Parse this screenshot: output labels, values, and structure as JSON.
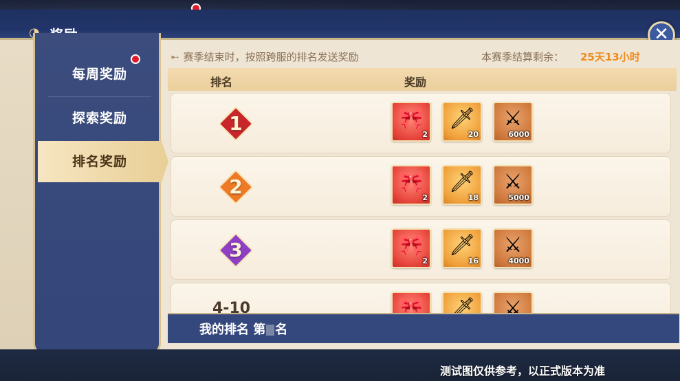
{
  "header": {
    "title": "奖励",
    "icon": "reward-icon",
    "close_label": "✕"
  },
  "sidebar": {
    "items": [
      {
        "label": "每周奖励",
        "active": false,
        "has_badge": true
      },
      {
        "label": "探索奖励",
        "active": false,
        "has_badge": false
      },
      {
        "label": "排名奖励",
        "active": true,
        "has_badge": false
      }
    ]
  },
  "notice": {
    "text": "赛季结束时，按照跨服的排名发送奖励",
    "season_label": "本赛季结算剩余：",
    "season_value": "25天13小时"
  },
  "table": {
    "col_rank": "排名",
    "col_reward": "奖励",
    "rows": [
      {
        "rank": "1",
        "badge_color": "#c8262a",
        "rewards": [
          {
            "icon": "red-scroll-icon",
            "count": "2"
          },
          {
            "icon": "golden-blade-icon",
            "count": "20"
          },
          {
            "icon": "jade-sword-icon",
            "count": "6000"
          }
        ]
      },
      {
        "rank": "2",
        "badge_color": "#ef7a26",
        "rewards": [
          {
            "icon": "red-scroll-icon",
            "count": "2"
          },
          {
            "icon": "golden-blade-icon",
            "count": "18"
          },
          {
            "icon": "jade-sword-icon",
            "count": "5000"
          }
        ]
      },
      {
        "rank": "3",
        "badge_color": "#8e3fc4",
        "rewards": [
          {
            "icon": "red-scroll-icon",
            "count": "2"
          },
          {
            "icon": "golden-blade-icon",
            "count": "16"
          },
          {
            "icon": "jade-sword-icon",
            "count": "4000"
          }
        ]
      },
      {
        "rank": "4-10",
        "badge_color": "",
        "rewards": [
          {
            "icon": "red-scroll-icon",
            "count": ""
          },
          {
            "icon": "golden-blade-icon",
            "count": ""
          },
          {
            "icon": "jade-sword-icon",
            "count": ""
          }
        ]
      }
    ]
  },
  "my_rank": {
    "prefix": "我的排名 第",
    "suffix": "名"
  },
  "disclaimer": "测试图仅供参考，以正式版本为准",
  "colors": {
    "accent_orange": "#f08a1a",
    "panel_blue": "#35487d",
    "cream": "#efe5d4"
  }
}
